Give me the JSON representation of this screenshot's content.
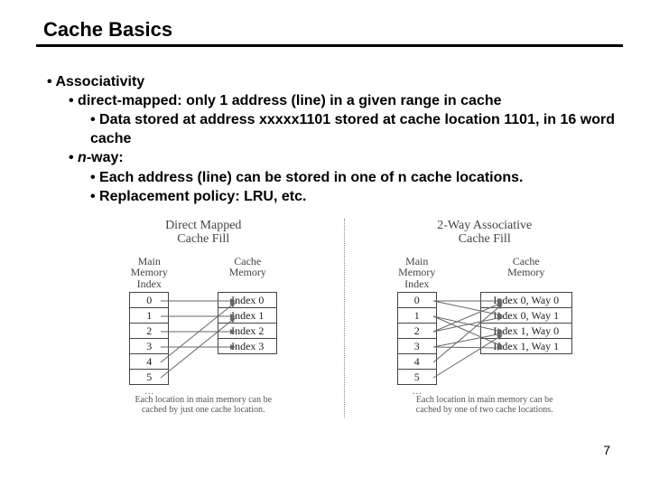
{
  "title": "Cache Basics",
  "page_number": "7",
  "bullets": {
    "l1": "Associativity",
    "l2a": "direct-mapped: only 1 address (line) in a given range in cache",
    "l3a": "Data stored at address xxxxx1101 stored at cache location 1101, in 16 word cache",
    "l2b_prefix": "n",
    "l2b_rest": "-way:",
    "l3b": "Each address (line) can be stored in one of n cache locations.",
    "l3c": "Replacement policy: LRU, etc."
  },
  "diagram1": {
    "title_l1": "Direct Mapped",
    "title_l2": "Cache Fill",
    "main_label_l1": "Main",
    "main_label_l2": "Memory",
    "main_label_sub": "Index",
    "cache_label_l1": "Cache",
    "cache_label_l2": "Memory",
    "main_rows": [
      "0",
      "1",
      "2",
      "3",
      "4",
      "5"
    ],
    "cache_rows": [
      "Index 0",
      "Index 1",
      "Index 2",
      "Index 3"
    ],
    "ellipsis": "…",
    "caption_l1": "Each location in main memory can be",
    "caption_l2": "cached by just one cache location."
  },
  "diagram2": {
    "title_l1": "2-Way Associative",
    "title_l2": "Cache Fill",
    "main_label_l1": "Main",
    "main_label_l2": "Memory",
    "main_label_sub": "Index",
    "cache_label_l1": "Cache",
    "cache_label_l2": "Memory",
    "main_rows": [
      "0",
      "1",
      "2",
      "3",
      "4",
      "5"
    ],
    "cache_rows": [
      "Index 0, Way 0",
      "Index 0, Way 1",
      "Index 1, Way 0",
      "Index 1, Way 1"
    ],
    "ellipsis": "…",
    "caption_l1": "Each location in main memory can be",
    "caption_l2": "cached by one of two cache locations."
  }
}
